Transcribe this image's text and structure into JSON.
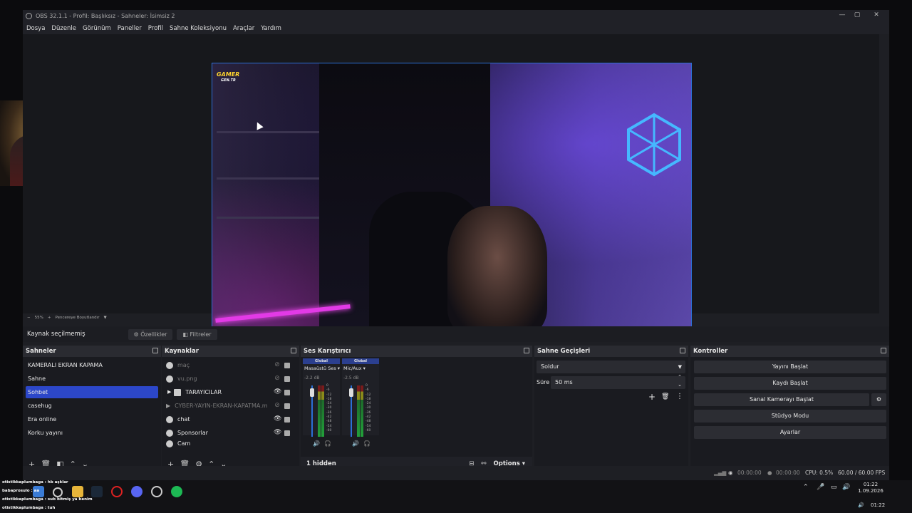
{
  "window": {
    "title": "OBS 32.1.1 - Profil: Başlıksız - Sahneler: İsimsiz 2",
    "controls": [
      "—",
      "▢",
      "✕"
    ]
  },
  "menu": [
    "Dosya",
    "Düzenle",
    "Görünüm",
    "Paneller",
    "Profil",
    "Sahne Koleksiyonu",
    "Araçlar",
    "Yardım"
  ],
  "preview": {
    "logo_line1": "GAMER",
    "logo_line2": "GEN.TR"
  },
  "zoom": {
    "minus": "−",
    "value": "55%",
    "plus": "+",
    "mode": "Pencereye Boyutlandır"
  },
  "source_toolbar": {
    "status": "Kaynak seçilmemiş",
    "properties": "Özellikler",
    "filters": "Filtreler"
  },
  "scenes": {
    "title": "Sahneler",
    "items": [
      "KAMERALI EKRAN KAPAMA",
      "Sahne",
      "Sohbet",
      "casehug",
      "Era online",
      "Korku yayını"
    ],
    "selected_index": 2
  },
  "sources": {
    "title": "Kaynaklar",
    "items": [
      {
        "label": "maç",
        "hidden": true
      },
      {
        "label": "vu.png",
        "hidden": true
      },
      {
        "label": "TARAYICILAR",
        "hidden": false
      },
      {
        "label": "CYBER-YAYIN-EKRAN-KAPATMA.m",
        "hidden": true
      },
      {
        "label": "chat",
        "hidden": false
      },
      {
        "label": "Sponsorlar",
        "hidden": false
      },
      {
        "label": "Cam",
        "hidden": false
      }
    ]
  },
  "mixer": {
    "title": "Ses Karıştırıcı",
    "channels": [
      {
        "scope": "Global",
        "name": "Masaüstü Ses",
        "db": "-2.2 dB"
      },
      {
        "scope": "Global",
        "name": "Mic/Aux",
        "db": "-2.5 dB"
      }
    ],
    "scale": [
      "0",
      "-6",
      "-12",
      "-18",
      "-24",
      "-30",
      "-36",
      "-42",
      "-48",
      "-54",
      "-60"
    ],
    "hidden_label": "1 hidden",
    "options_label": "Options"
  },
  "transitions": {
    "title": "Sahne Geçişleri",
    "selected": "Soldur",
    "duration_label": "Süre",
    "duration_value": "50 ms"
  },
  "controls": {
    "title": "Kontroller",
    "buttons": [
      "Yayını Başlat",
      "Kaydı Başlat",
      "Sanal Kamerayı Başlat",
      "Stüdyo Modu",
      "Ayarlar"
    ]
  },
  "status": {
    "stream_time": "00:00:00",
    "record_time": "00:00:00",
    "cpu": "CPU: 0.5%",
    "fps": "60.00 / 60.00 FPS"
  },
  "chat_overlay": [
    "otistikkaplumbaga : hb aşklar",
    "babaprosulo : aa",
    "otistikkaplumbaga : sub bitmiş ya benim",
    "otistikkaplumbaga : tuh"
  ],
  "clock": {
    "time": "01:22",
    "date": "1.09.2026",
    "time2": "01:22"
  },
  "colors": {
    "accent": "#2c47c9",
    "panel": "#1a1b20",
    "header": "#2a2b31"
  }
}
